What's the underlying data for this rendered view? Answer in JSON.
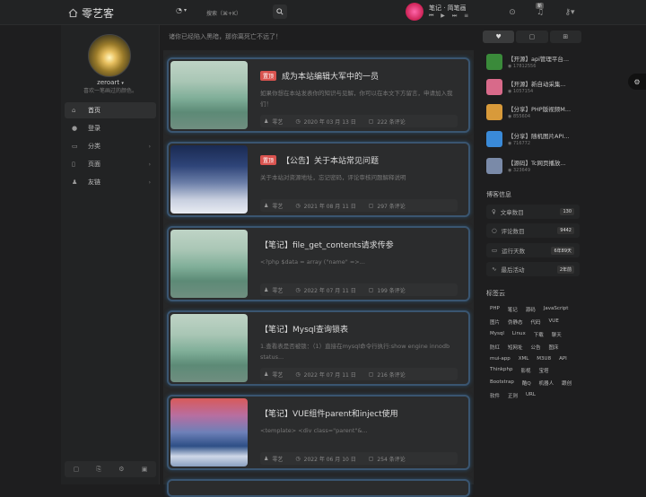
{
  "site": {
    "title": "零艺客"
  },
  "search": {
    "label": "搜索（⌘+K）"
  },
  "player": {
    "song": "笔记 · 简笔画",
    "controls": "⏮ ▶ ⏭ ≡"
  },
  "topbar": {
    "notify_badge": "新"
  },
  "profile": {
    "name": "zeroart",
    "motto": "喜欢一笔画过的颜色。"
  },
  "nav": [
    {
      "label": "首页",
      "icon": "home-icon"
    },
    {
      "label": "登录",
      "icon": "user-icon"
    },
    {
      "label": "分类",
      "icon": "folder-icon",
      "arrow": "›"
    },
    {
      "label": "页面",
      "icon": "file-icon",
      "arrow": "›"
    },
    {
      "label": "友链",
      "icon": "user-icon",
      "arrow": "›"
    }
  ],
  "notice": "诸你已经陷入黑暗，那你离死亡不远了！",
  "posts": [
    {
      "tag": "置顶",
      "title": "成为本站编辑大军中的一员",
      "desc": "如果你想在本站发表你的知识与见解，你可以在本文下方留言，申请加入我们！",
      "author": "零艺",
      "date": "2020 年 03 月 13 日",
      "comments": "222 条评论",
      "thumb": "th-boat"
    },
    {
      "tag": "置顶",
      "title": "【公告】关于本站常见问题",
      "desc": "关于本站对资源地址，忘记密码，评论审核问题解释说明",
      "author": "零艺",
      "date": "2021 年 08 月 11 日",
      "comments": "297 条评论",
      "thumb": "th-snow"
    },
    {
      "tag": "",
      "title": "【笔记】file_get_contents请求传参",
      "desc": "<?php $data = array (\"name\" =>...",
      "author": "零艺",
      "date": "2022 年 07 月 11 日",
      "comments": "199 条评论",
      "thumb": "th-boat"
    },
    {
      "tag": "",
      "title": "【笔记】Mysql查询锁表",
      "desc": "1.查看表是否被锁：（1）直接在mysql命令行执行:show engine innodb status...",
      "author": "零艺",
      "date": "2022 年 07 月 11 日",
      "comments": "216 条评论",
      "thumb": "th-boat"
    },
    {
      "tag": "",
      "title": "【笔记】VUE组件parent和inject使用",
      "desc": "<template> <div class=\"parent\"&...",
      "author": "零艺",
      "date": "2022 年 06 月 10 日",
      "comments": "254 条评论",
      "thumb": "th-mtn"
    }
  ],
  "hot": [
    {
      "title": "【开源】api管理平台...",
      "views": "17812556",
      "color": "#3a8a3a"
    },
    {
      "title": "【开源】新自动采集...",
      "views": "1057154",
      "color": "#d86a8a"
    },
    {
      "title": "【分享】PHP版视频M...",
      "views": "855604",
      "color": "#d89a3a"
    },
    {
      "title": "【分享】随机图片API...",
      "views": "716772",
      "color": "#3a8ad8"
    },
    {
      "title": "【源码】Tc网页播放...",
      "views": "323649",
      "color": "#7a8aa8"
    }
  ],
  "blog_info": {
    "title": "博客信息",
    "items": [
      {
        "label": "文章数目",
        "value": "130",
        "icon": "article-icon"
      },
      {
        "label": "评论数目",
        "value": "9442",
        "icon": "comment-icon"
      },
      {
        "label": "运行天数",
        "value": "6年89天",
        "icon": "calendar-icon"
      },
      {
        "label": "最后活动",
        "value": "2年前",
        "icon": "activity-icon"
      }
    ]
  },
  "tag_cloud": {
    "title": "标签云",
    "tags": [
      "PHP",
      "笔记",
      "源码",
      "JavaScript",
      "图片",
      "伪静态",
      "代码",
      "VUE",
      "Mysql",
      "Linux",
      "下载",
      "聊天",
      "防红",
      "短网址",
      "公告",
      "图床",
      "mui-app",
      "XML",
      "M3U8",
      "API",
      "Thinkphp",
      "影视",
      "宝塔",
      "Bootstrap",
      "酷Q",
      "机器人",
      "跟创",
      "软件",
      "正则",
      "URL"
    ]
  }
}
